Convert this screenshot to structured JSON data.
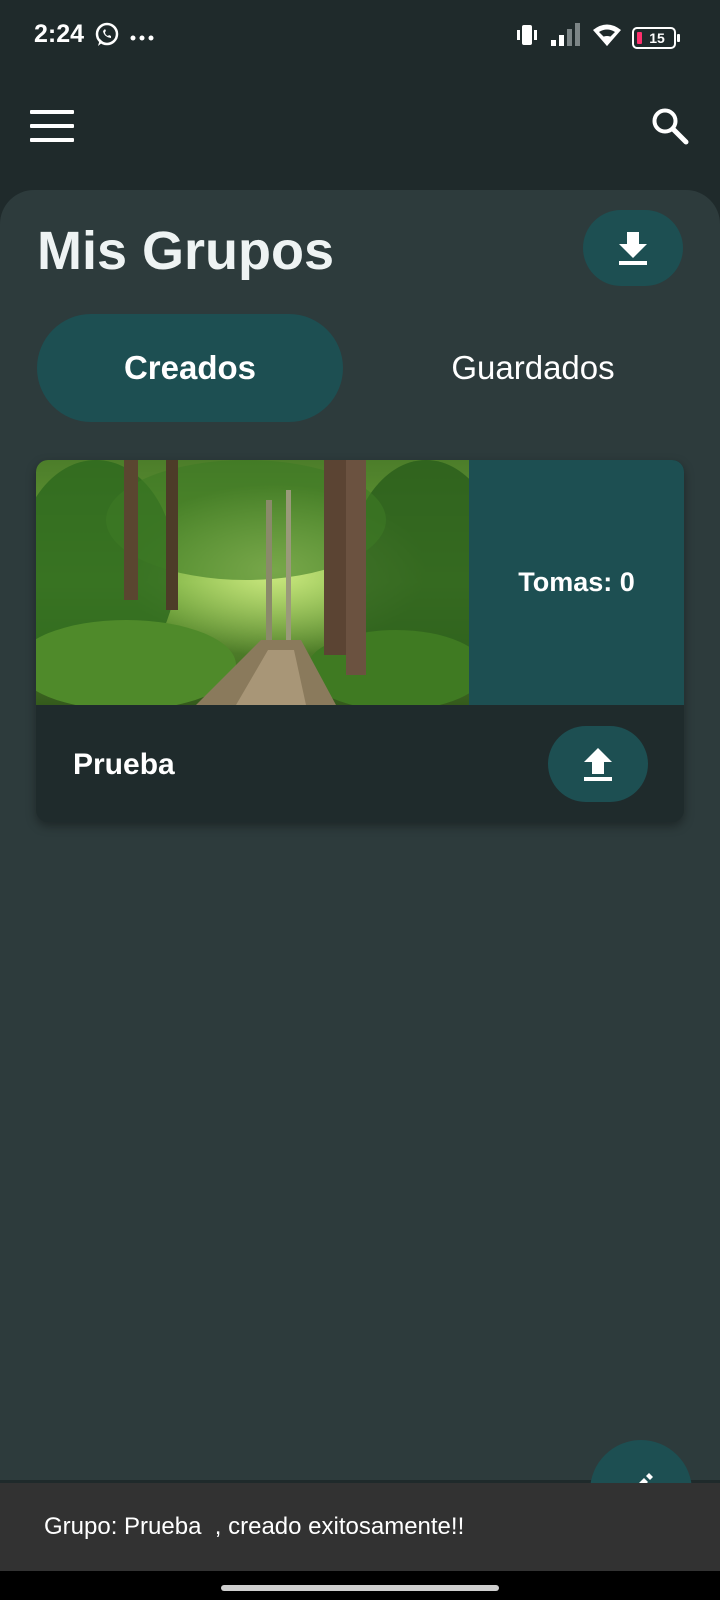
{
  "status_bar": {
    "time": "2:24",
    "notification_icons": [
      "whatsapp-icon",
      "more-dots-icon"
    ],
    "system_icons": [
      "vibrate-icon",
      "signal-icon",
      "wifi-icon",
      "battery-icon"
    ],
    "battery_level": "15",
    "battery_color": "#ff2f6d"
  },
  "app_bar": {
    "menu_icon": "hamburger-menu-icon",
    "search_icon": "search-icon"
  },
  "main": {
    "title": "Mis Grupos",
    "download_icon": "download-icon",
    "tabs": [
      {
        "label": "Creados",
        "active": true
      },
      {
        "label": "Guardados",
        "active": false
      }
    ],
    "groups": [
      {
        "name": "Prueba",
        "stats": "Tomas: 0",
        "image": "forest-path-photo",
        "action_icon": "upload-icon"
      }
    ]
  },
  "fab": {
    "icon": "edit-icon"
  },
  "snackbar": {
    "message": "Grupo: Prueba  , creado exitosamente!!"
  },
  "colors": {
    "background": "#1f2a2b",
    "panel": "#2d3b3c",
    "accent": "#1d4f52",
    "card": "#1f2b2c",
    "snackbar": "#323232"
  }
}
